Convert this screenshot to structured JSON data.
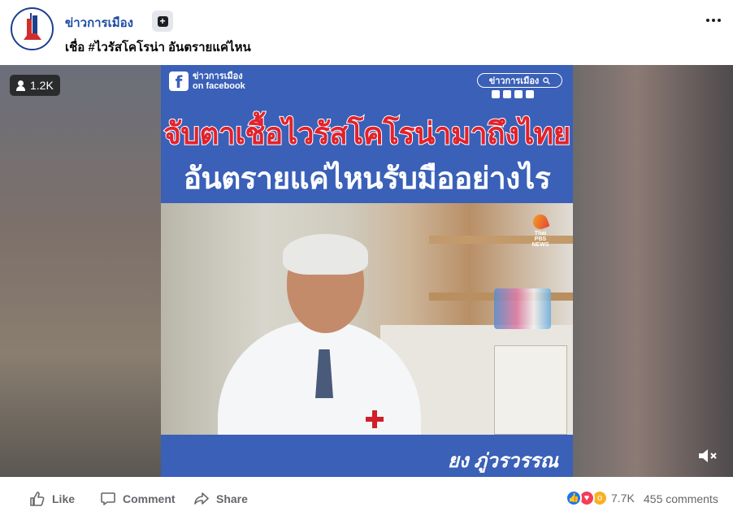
{
  "post": {
    "page_name": "ข่าวการเมือง",
    "caption": "เชื่อ #ไวรัสโคโรน่า อันตรายแค่ไหน"
  },
  "video": {
    "viewers": "1.2K",
    "overlay": {
      "fb_brand_line1": "ข่าวการเมือง",
      "fb_brand_line2": "on facebook",
      "search_label": "ข่าวการเมือง",
      "headline_line1": "จับตาเชื้อไวรัสโคโรน่ามาถึงไทย",
      "headline_line2": "อันตรายแค่ไหนรับมืออย่างไร",
      "speaker_name": "ยง  ภู่วรวรรณ",
      "tv_badge": "Thai PBS NEWS"
    }
  },
  "actions": {
    "like_label": "Like",
    "comment_label": "Comment",
    "share_label": "Share"
  },
  "stats": {
    "reactions_count": "7.7K",
    "comments_count": "455 comments",
    "reaction_types": [
      "like",
      "love",
      "wow"
    ]
  },
  "colors": {
    "brand_blue": "#3a60b8",
    "page_name": "#1c4da1",
    "headline_red": "#e2222b"
  }
}
